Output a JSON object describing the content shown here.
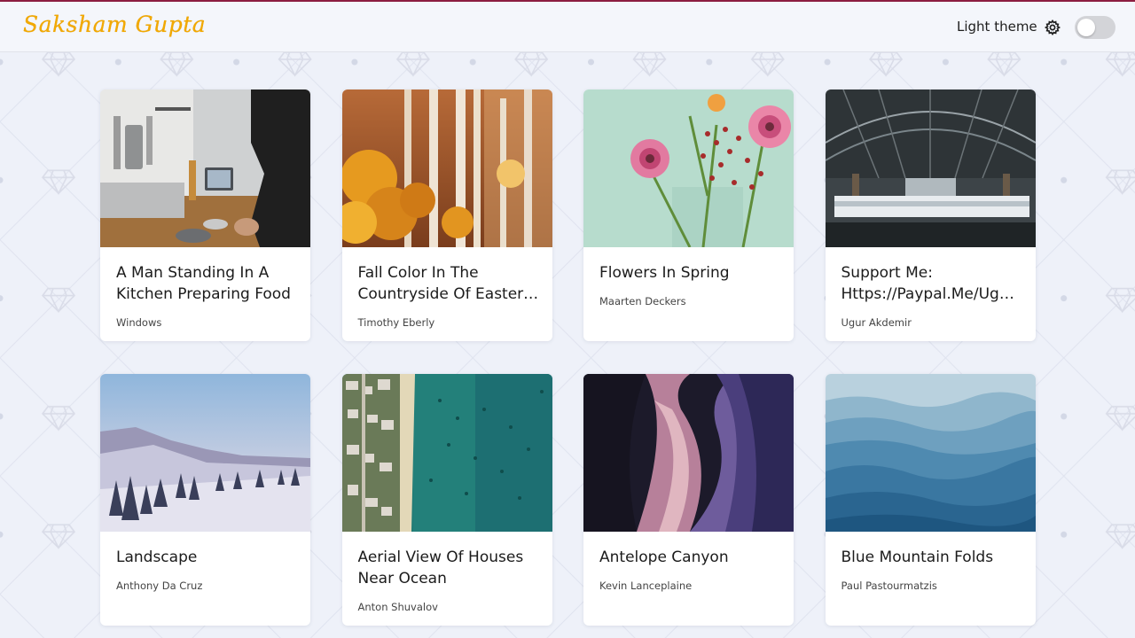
{
  "brand": {
    "name": "Saksham Gupta",
    "color": "#f2a900"
  },
  "header": {
    "theme_label": "Light theme",
    "settings_icon": "gear-icon",
    "theme_toggle_on": false
  },
  "cards": [
    {
      "title": "A Man Standing In A Kitchen Preparing Food",
      "author": "Windows"
    },
    {
      "title": "Fall Color In The Countryside Of Easter…",
      "author": "Timothy Eberly"
    },
    {
      "title": "Flowers In Spring",
      "author": "Maarten Deckers"
    },
    {
      "title": "Support Me: Https://Paypal.Me/Ug…",
      "author": "Ugur Akdemir"
    },
    {
      "title": "Landscape",
      "author": "Anthony Da Cruz"
    },
    {
      "title": "Aerial View Of Houses Near Ocean",
      "author": "Anton Shuvalov"
    },
    {
      "title": "Antelope Canyon",
      "author": "Kevin Lanceplaine"
    },
    {
      "title": "Blue Mountain Folds",
      "author": "Paul Pastourmatzis"
    }
  ]
}
